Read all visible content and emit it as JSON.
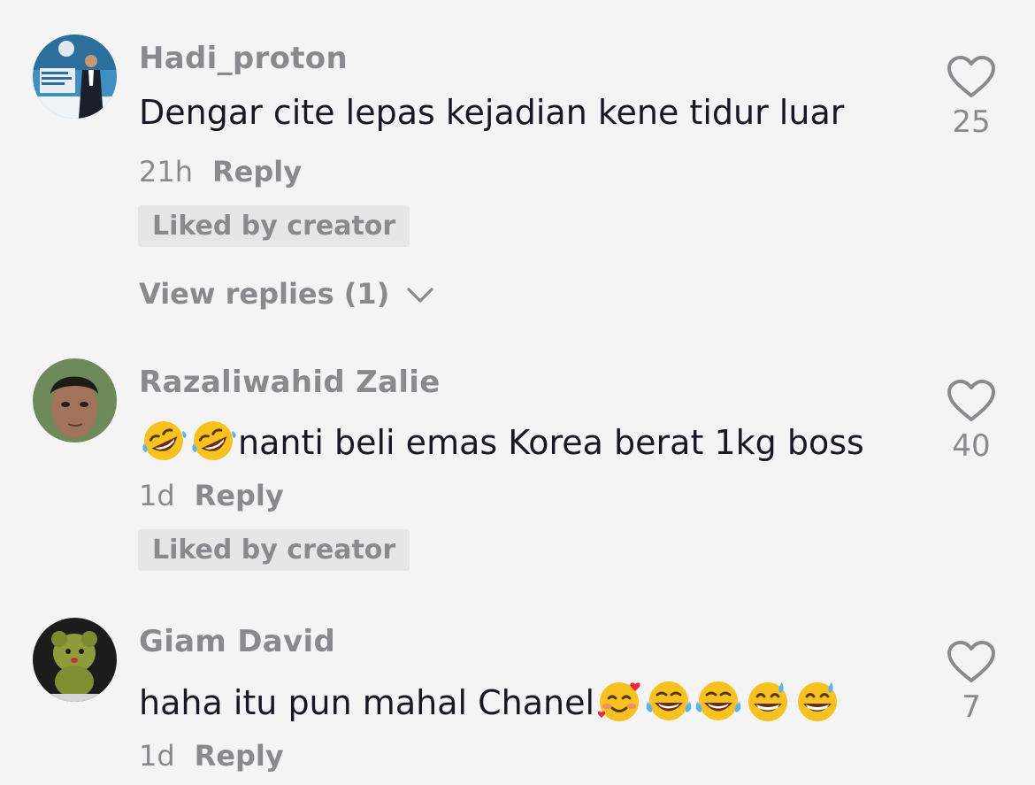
{
  "comments": [
    {
      "username": "Hadi_proton",
      "text": "Dengar cite lepas kejadian kene tidur luar",
      "time": "21h",
      "reply_label": "Reply",
      "badge": "Liked by creator",
      "view_replies": "View replies (1)",
      "likes": "25"
    },
    {
      "username": "Razaliwahid Zalie",
      "text": "nanti beli emas Korea berat 1kg boss",
      "emojis": [
        "rofl-emoji",
        "rofl-emoji"
      ],
      "time": "1d",
      "reply_label": "Reply",
      "badge": "Liked by creator",
      "likes": "40"
    },
    {
      "username": "Giam David",
      "text": "haha itu pun mahal Chanel",
      "emojis": [
        "smiling-hearts-emoji",
        "tears-of-joy-emoji",
        "tears-of-joy-emoji",
        "grin-sweat-emoji",
        "grin-sweat-emoji"
      ],
      "time": "1d",
      "reply_label": "Reply",
      "likes": "7"
    }
  ]
}
